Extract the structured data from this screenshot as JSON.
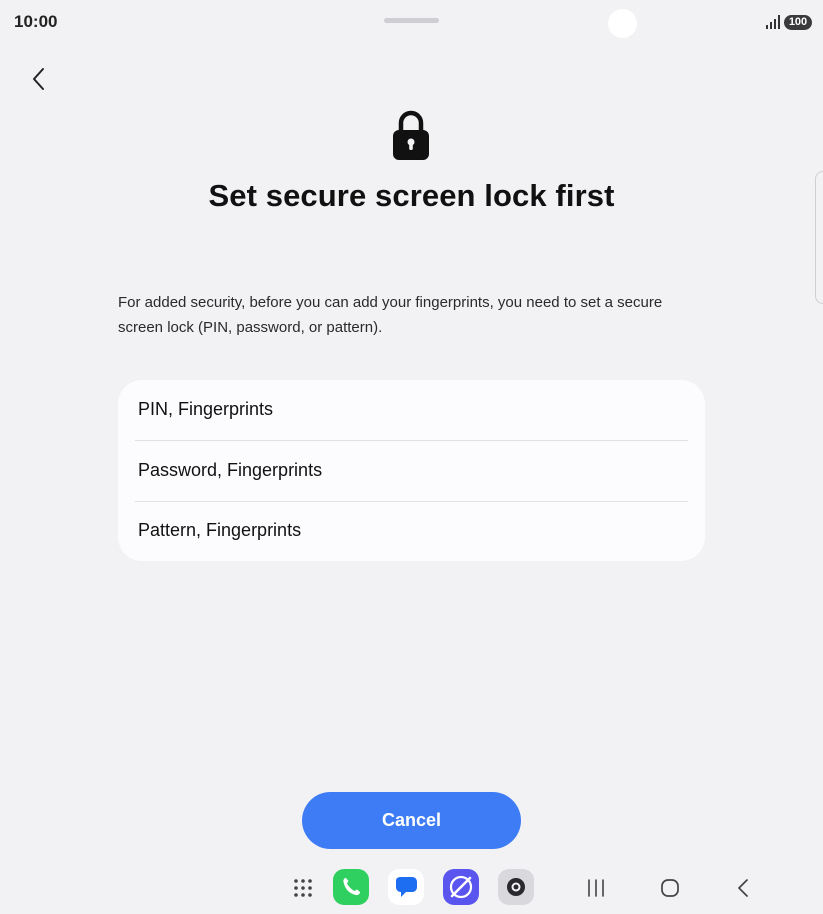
{
  "status_bar": {
    "time": "10:00",
    "battery": "100"
  },
  "screen": {
    "title": "Set secure screen lock first",
    "description": "For added security, before you can add your fingerprints, you need to set a secure screen lock (PIN, password, or pattern).",
    "options": [
      {
        "label": "PIN, Fingerprints"
      },
      {
        "label": "Password, Fingerprints"
      },
      {
        "label": "Pattern, Fingerprints"
      }
    ],
    "cancel_label": "Cancel"
  },
  "nav_bar": {
    "apps": [
      {
        "icon": "app-drawer-icon"
      },
      {
        "icon": "phone-app-icon",
        "color": "#2fcf60"
      },
      {
        "icon": "messages-app-icon",
        "color": "#1e6ef2"
      },
      {
        "icon": "internet-app-icon",
        "color": "#5b55f0"
      },
      {
        "icon": "camera-app-icon",
        "color": "#d9d9dd"
      }
    ],
    "buttons": [
      "recents-icon",
      "home-icon",
      "back-icon"
    ]
  },
  "colors": {
    "background": "#f2f2f4",
    "card": "#fcfcfe",
    "accent": "#3e7cf5"
  }
}
